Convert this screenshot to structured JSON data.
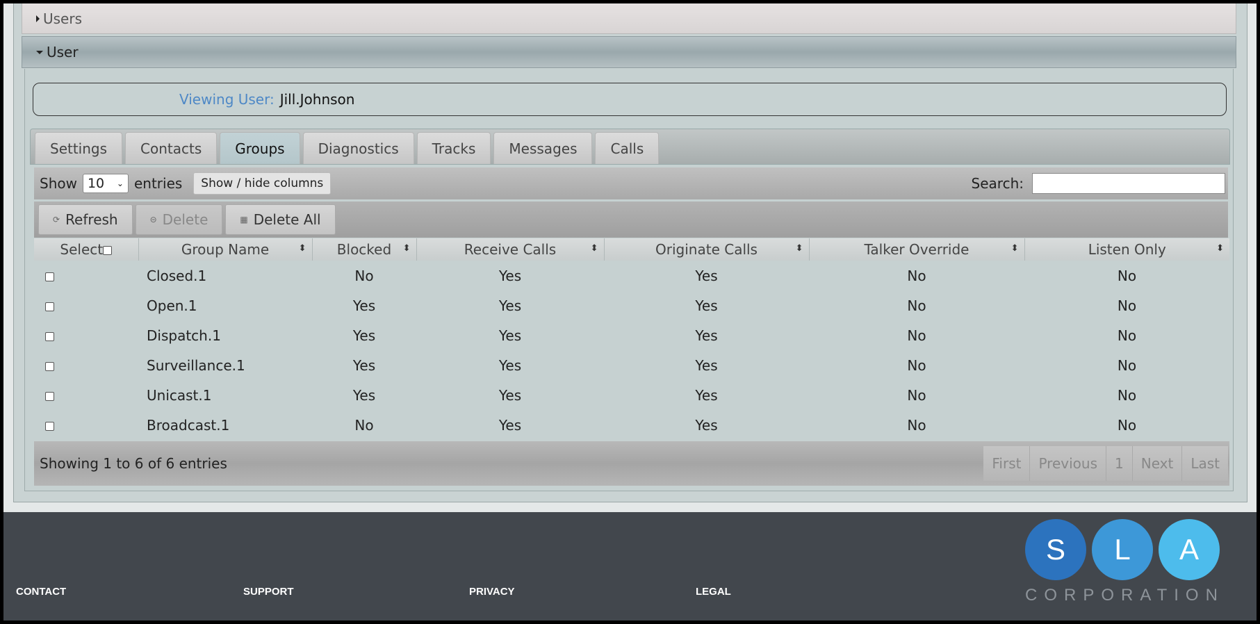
{
  "accordion": {
    "users_label": "Users",
    "user_label": "User"
  },
  "viewing": {
    "label": "Viewing User:",
    "value": "Jill.Johnson"
  },
  "tabs": [
    {
      "label": "Settings",
      "active": false
    },
    {
      "label": "Contacts",
      "active": false
    },
    {
      "label": "Groups",
      "active": true
    },
    {
      "label": "Diagnostics",
      "active": false
    },
    {
      "label": "Tracks",
      "active": false
    },
    {
      "label": "Messages",
      "active": false
    },
    {
      "label": "Calls",
      "active": false
    }
  ],
  "toolbar": {
    "show_label": "Show",
    "length_value": "10",
    "entries_label": "entries",
    "colvis_label": "Show / hide columns",
    "search_label": "Search:",
    "search_value": ""
  },
  "actions": {
    "refresh": "Refresh",
    "delete": "Delete",
    "delete_all": "Delete All"
  },
  "table": {
    "headers": [
      "Select",
      "Group Name",
      "Blocked",
      "Receive Calls",
      "Originate Calls",
      "Talker Override",
      "Listen Only"
    ],
    "rows": [
      {
        "name": "Closed.1",
        "blocked": "No",
        "receive": "Yes",
        "originate": "Yes",
        "talker": "No",
        "listen": "No"
      },
      {
        "name": "Open.1",
        "blocked": "Yes",
        "receive": "Yes",
        "originate": "Yes",
        "talker": "No",
        "listen": "No"
      },
      {
        "name": "Dispatch.1",
        "blocked": "Yes",
        "receive": "Yes",
        "originate": "Yes",
        "talker": "No",
        "listen": "No"
      },
      {
        "name": "Surveillance.1",
        "blocked": "Yes",
        "receive": "Yes",
        "originate": "Yes",
        "talker": "No",
        "listen": "No"
      },
      {
        "name": "Unicast.1",
        "blocked": "Yes",
        "receive": "Yes",
        "originate": "Yes",
        "talker": "No",
        "listen": "No"
      },
      {
        "name": "Broadcast.1",
        "blocked": "No",
        "receive": "Yes",
        "originate": "Yes",
        "talker": "No",
        "listen": "No"
      }
    ]
  },
  "info": "Showing 1 to 6 of 6 entries",
  "pager": {
    "first": "First",
    "previous": "Previous",
    "page": "1",
    "next": "Next",
    "last": "Last"
  },
  "footer": {
    "contact": "CONTACT",
    "support": "SUPPORT",
    "privacy": "PRIVACY",
    "legal": "LEGAL",
    "logo_letters": [
      "S",
      "L",
      "A"
    ],
    "logo_sub": "CORPORATION",
    "logo_colors": [
      "#2c73be",
      "#3d98d8",
      "#4dbcec"
    ]
  }
}
